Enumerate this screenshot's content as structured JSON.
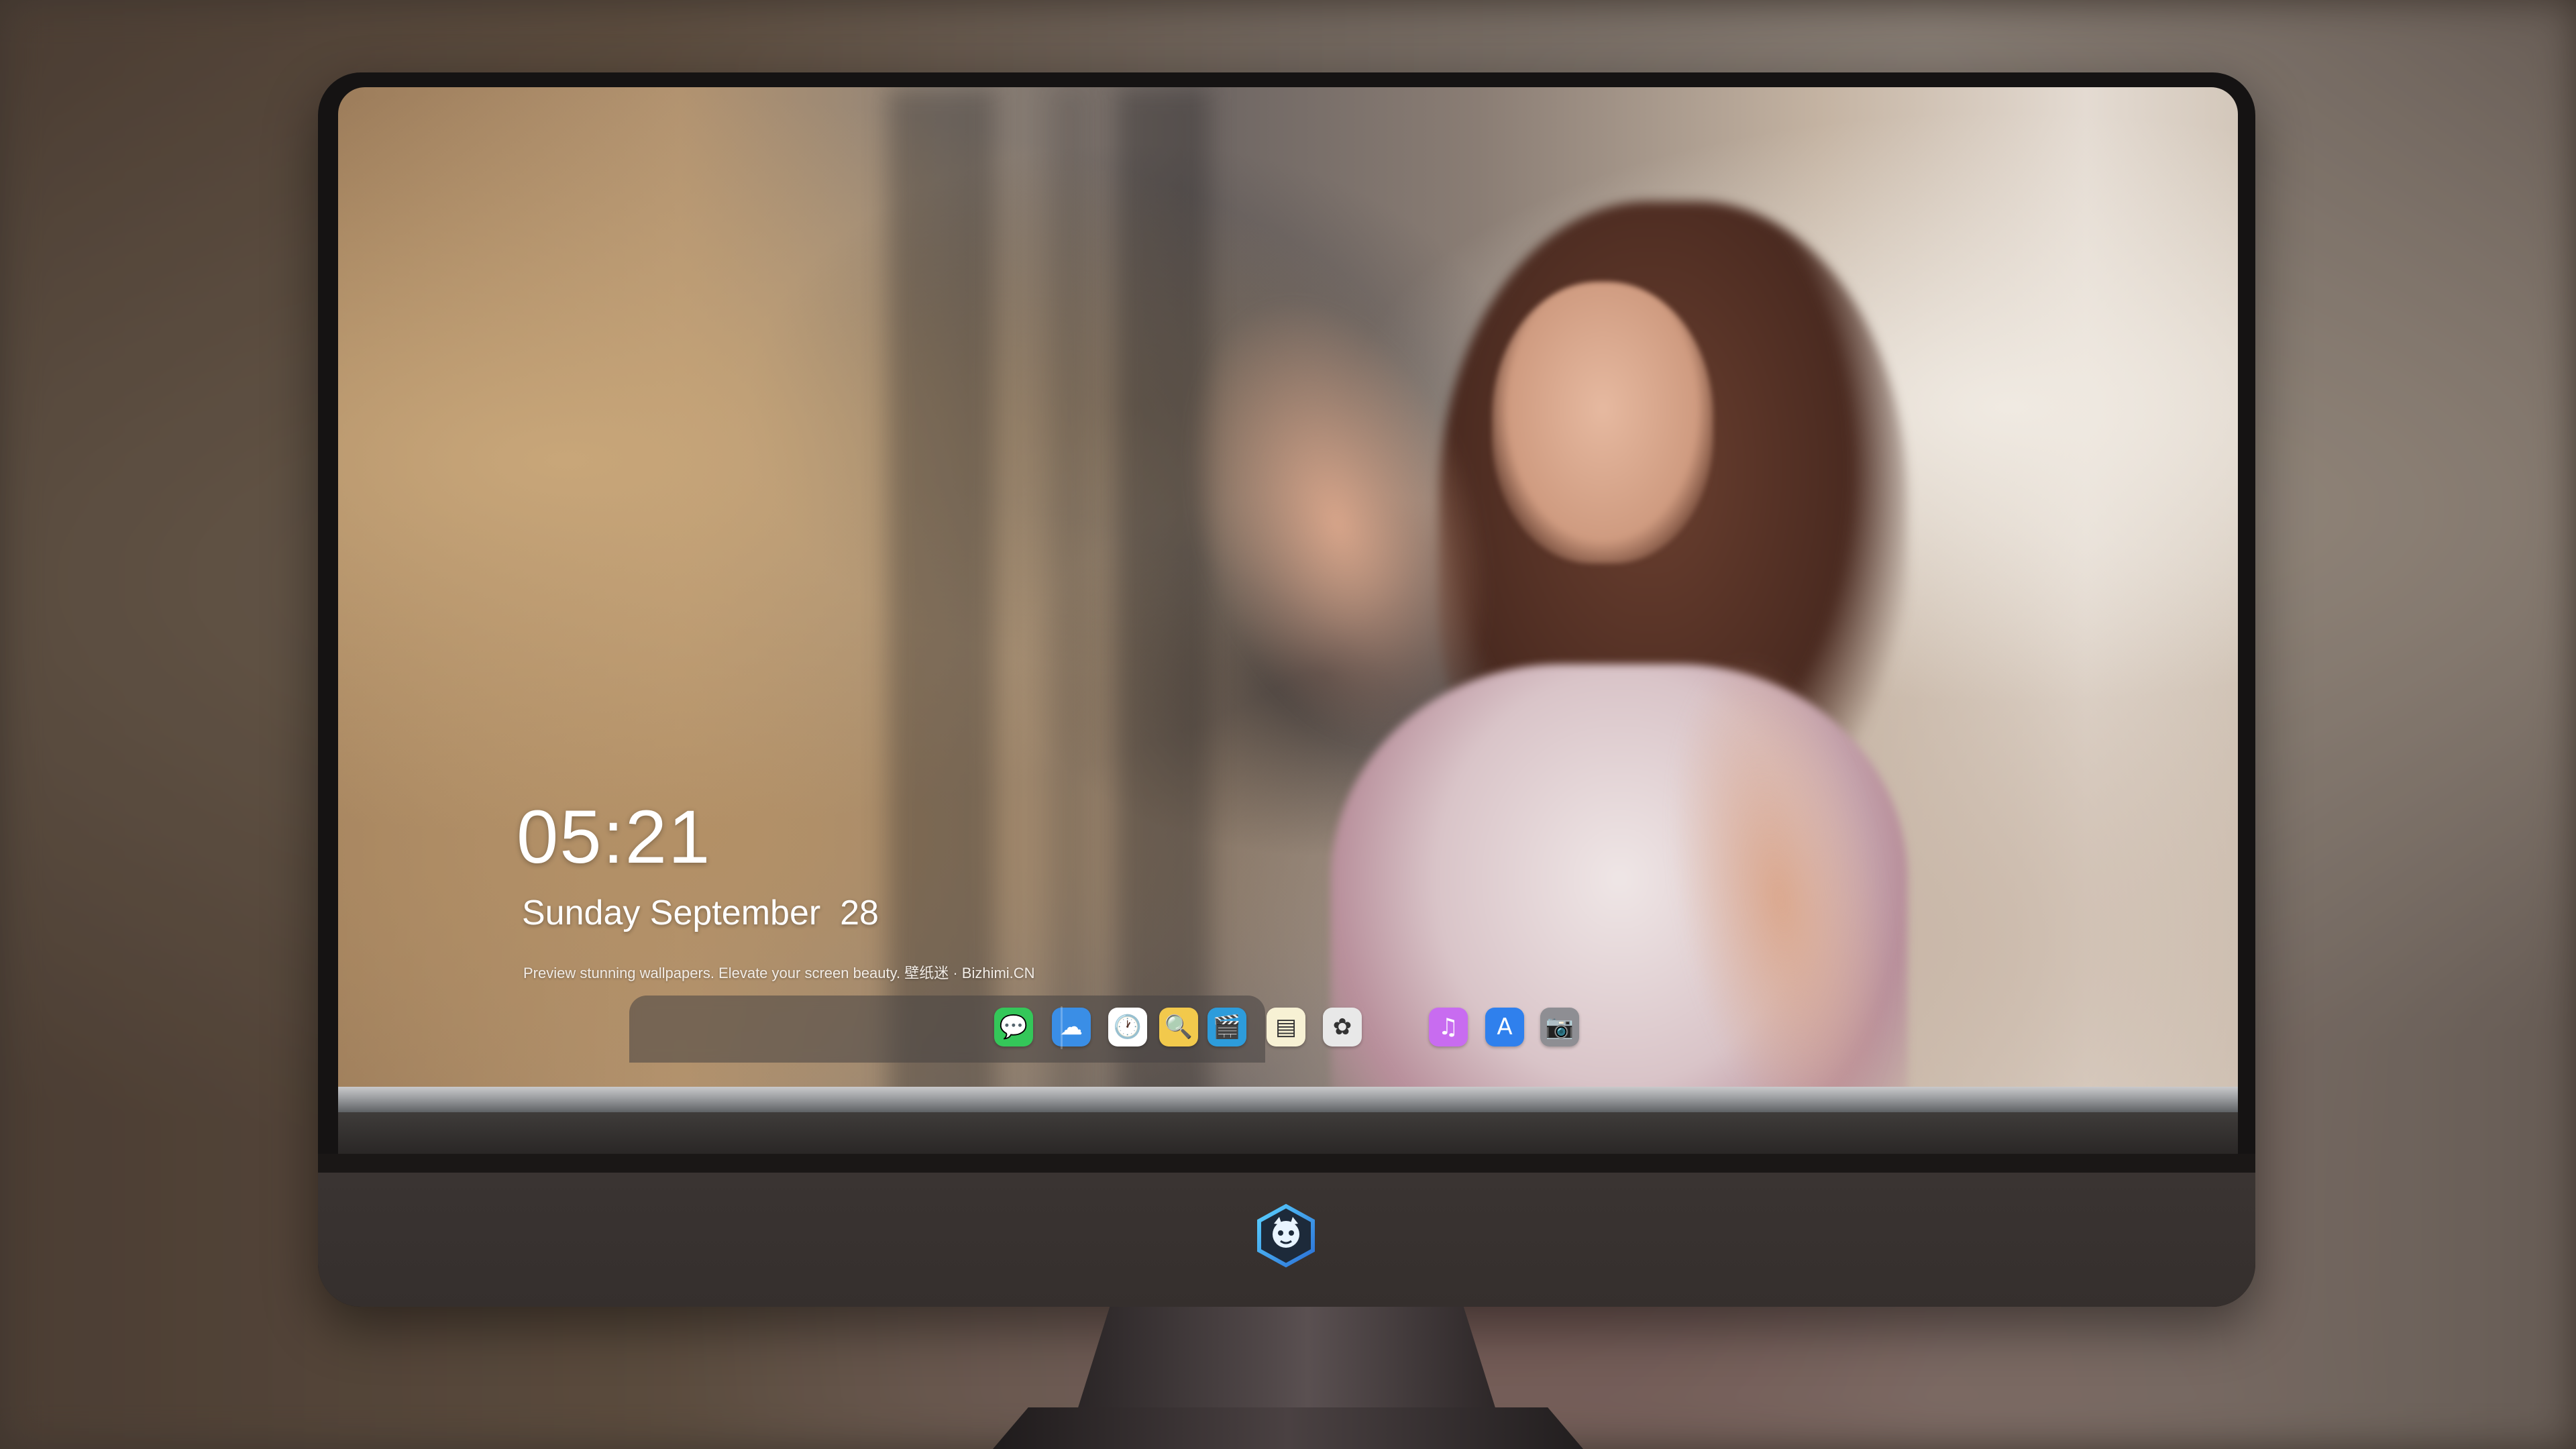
{
  "lockscreen": {
    "time": "05:21",
    "date": "Sunday September  28",
    "tagline": "Preview stunning wallpapers. Elevate your screen beauty. 壁纸迷 · Bizhimi.CN"
  },
  "dock": {
    "apps": [
      {
        "name": "messages-icon",
        "glyph": "💬",
        "color": "#34c759"
      },
      {
        "name": "weather-icon",
        "glyph": "☁",
        "color": "#3a8ee6"
      },
      {
        "name": "clock-icon",
        "glyph": "🕐",
        "color": "#ffffff"
      },
      {
        "name": "preview-icon",
        "glyph": "🔍",
        "color": "#f2c94c"
      },
      {
        "name": "clips-icon",
        "glyph": "🎬",
        "color": "#2d9cdb"
      },
      {
        "name": "notes-icon",
        "glyph": "▤",
        "color": "#f7f1d4"
      },
      {
        "name": "photos-icon",
        "glyph": "✿",
        "color": "#e8e8e8"
      },
      {
        "name": "music-icon",
        "glyph": "♫",
        "color": "#c86cf0"
      },
      {
        "name": "app-store-icon",
        "glyph": "A",
        "color": "#2f80ed"
      },
      {
        "name": "camera-icon",
        "glyph": "📷",
        "color": "#8e8e93"
      }
    ]
  },
  "colors": {
    "accent": "#2f80ed",
    "bezel": "#151313",
    "chin": "#3a3432"
  }
}
